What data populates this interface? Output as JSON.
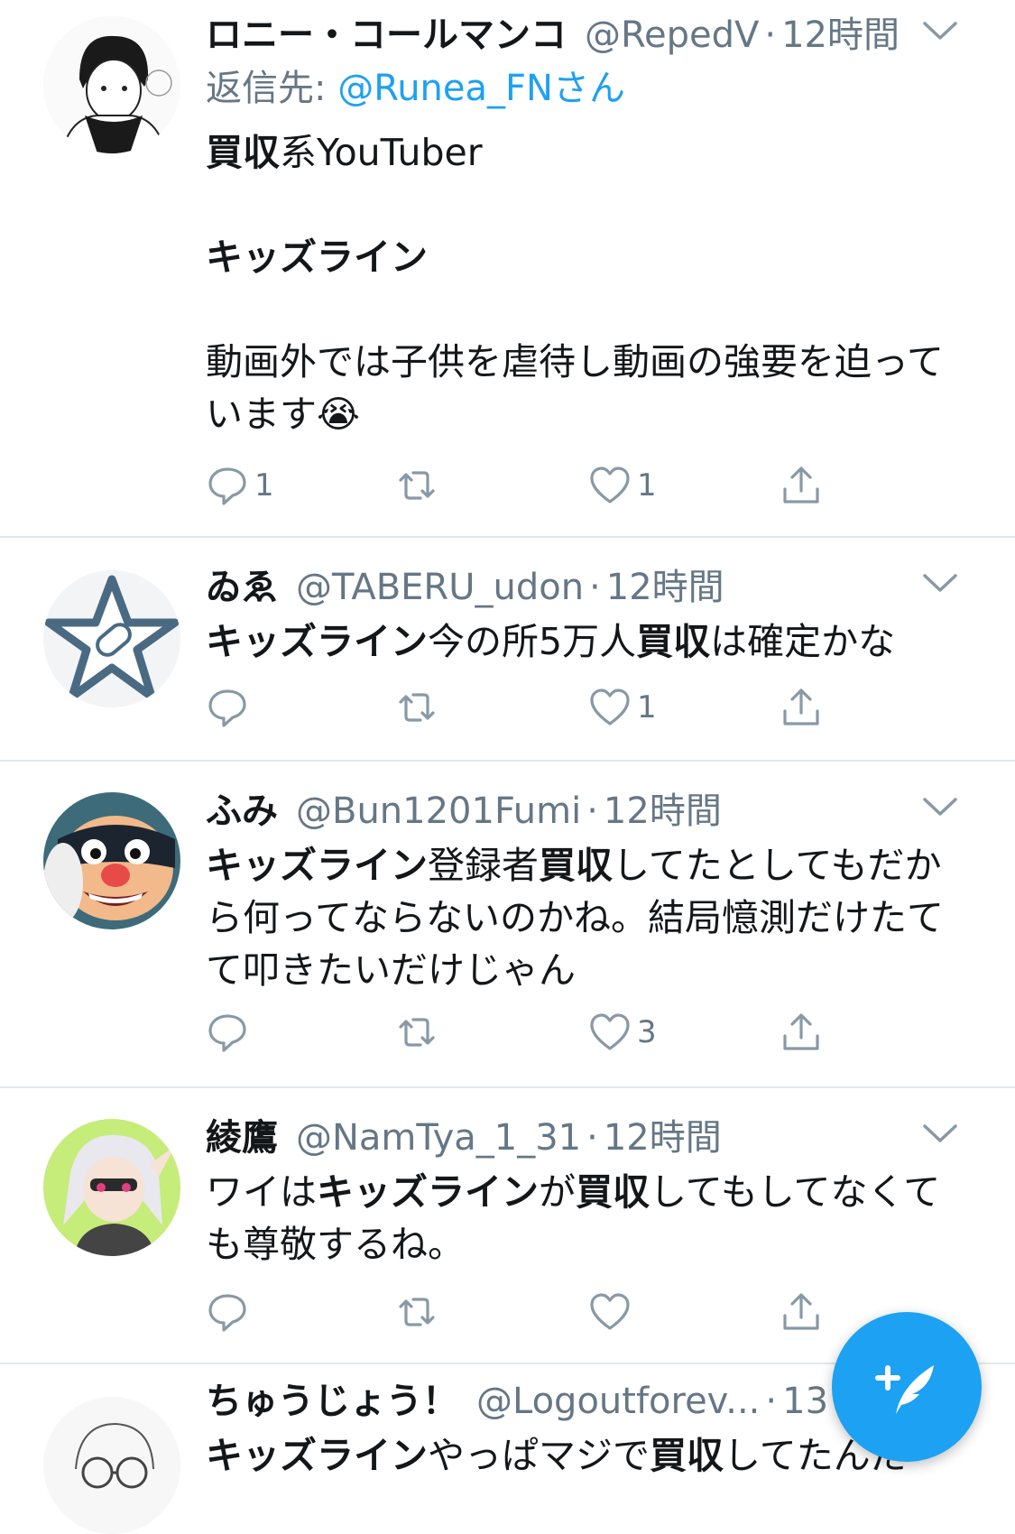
{
  "tweets": [
    {
      "name": "ロニー・コールマンコ",
      "handle": "@RepedV",
      "time": "12時間",
      "reply_prefix": "返信先: ",
      "reply_mention": "@Runea_FNさん",
      "body_line1_bold": "買収",
      "body_line1_rest": "系YouTuber",
      "body_line2_bold": "キッズライン",
      "body_line3": "動画外では子供を虐待し動画の強要を迫っています😭",
      "replies": "1",
      "retweets": "",
      "likes": "1",
      "avatar_icon": "manga-boy-avatar"
    },
    {
      "name": "ゐゑ",
      "handle": "@TABERU_udon",
      "time": "12時間",
      "seg1_bold": "キッズライン",
      "seg2": "今の所5万人",
      "seg3_bold": "買収",
      "seg4": "は確定かな",
      "replies": "",
      "retweets": "",
      "likes": "1",
      "avatar_icon": "star-pill-avatar"
    },
    {
      "name": "ふみ",
      "handle": "@Bun1201Fumi",
      "time": "12時間",
      "seg1_bold": "キッズライン",
      "seg2": "登録者",
      "seg3_bold": "買収",
      "seg4": "してたとしてもだから何ってならないのかね。結局憶測だけたてて叩きたいだけじゃん",
      "replies": "",
      "retweets": "",
      "likes": "3",
      "avatar_icon": "masked-face-avatar"
    },
    {
      "name": "綾鷹",
      "handle": "@NamTya_1_31",
      "time": "12時間",
      "seg1": "ワイは",
      "seg2_bold": "キッズライン",
      "seg3": "が",
      "seg4_bold": "買収",
      "seg5": "してもしてなくても尊敬するね。",
      "replies": "",
      "retweets": "",
      "likes": "",
      "avatar_icon": "squid-girl-avatar"
    },
    {
      "name": "ちゅうじょう！",
      "handle": "@Logoutforev...",
      "time": "13",
      "seg1_bold": "キッズライン",
      "seg2": "やっぱマジで",
      "seg3_bold": "買収",
      "seg4": "してたんだ",
      "avatar_icon": "sketch-glasses-avatar"
    }
  ],
  "compose_button": {
    "icon": "compose-feather-icon"
  },
  "colors": {
    "accent": "#1da1f2",
    "muted": "#657786",
    "divider": "#e1e8ed"
  }
}
